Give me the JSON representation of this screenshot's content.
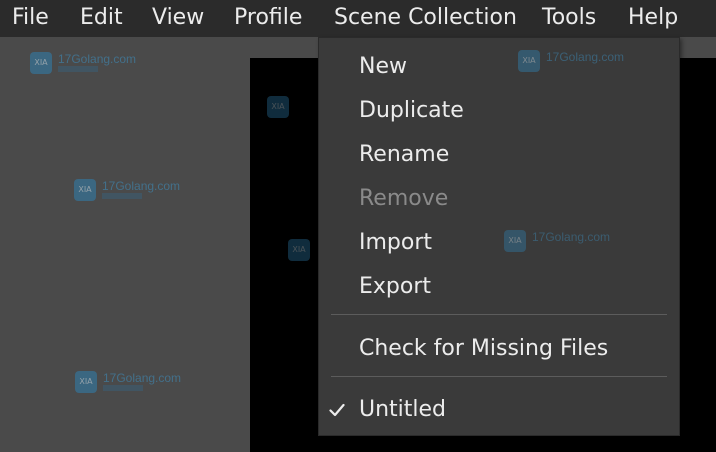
{
  "menubar": {
    "items": [
      {
        "label": "File"
      },
      {
        "label": "Edit"
      },
      {
        "label": "View"
      },
      {
        "label": "Profile"
      },
      {
        "label": "Scene Collection"
      },
      {
        "label": "Tools"
      },
      {
        "label": "Help"
      }
    ]
  },
  "scene_collection_menu": {
    "items": [
      {
        "label": "New",
        "enabled": true
      },
      {
        "label": "Duplicate",
        "enabled": true
      },
      {
        "label": "Rename",
        "enabled": true
      },
      {
        "label": "Remove",
        "enabled": false
      },
      {
        "label": "Import",
        "enabled": true
      },
      {
        "label": "Export",
        "enabled": true
      }
    ],
    "check_missing_label": "Check for Missing Files",
    "collections": [
      {
        "label": "Untitled",
        "checked": true,
        "icon": "checkmark-icon"
      }
    ]
  },
  "watermark": {
    "text": "17Golang.com",
    "logo_text": "XIA",
    "color": "#3d8fc0"
  },
  "colors": {
    "menubar_bg": "#2b2b2b",
    "background": "#4a4a4a",
    "canvas_bg": "#000000",
    "dropdown_bg": "#3a3a3a",
    "text": "#ececec",
    "disabled_text": "#8a8a8a"
  }
}
